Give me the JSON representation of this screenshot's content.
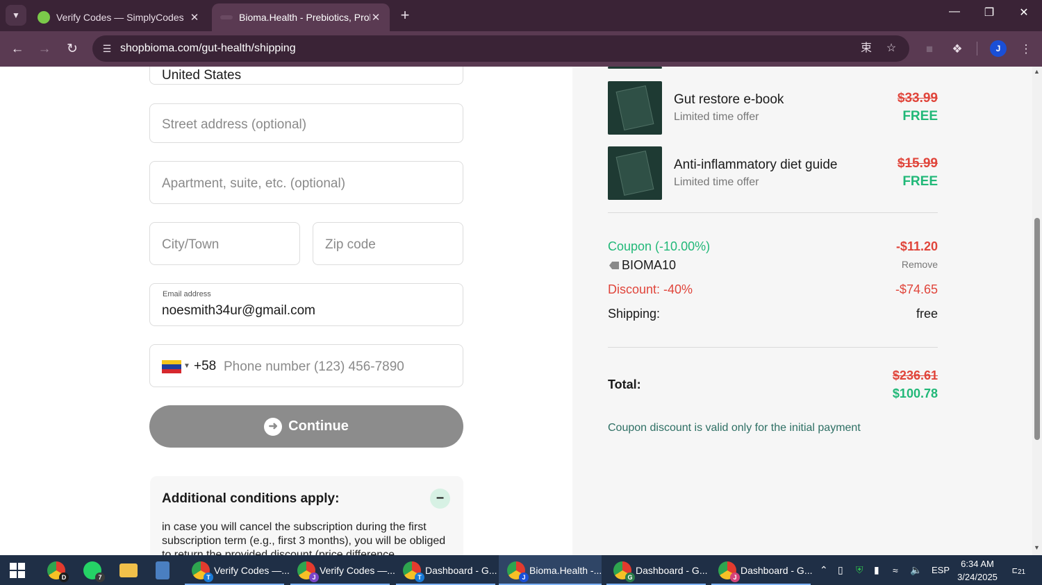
{
  "browser": {
    "tabs": [
      {
        "title": "Verify Codes — SimplyCodes",
        "active": false
      },
      {
        "title": "Bioma.Health - Prebiotics, Probiotics",
        "active": true
      }
    ],
    "url": "shopbioma.com/gut-health/shipping",
    "profile_initial": "J"
  },
  "form": {
    "country_value": "United States",
    "street_placeholder": "Street address (optional)",
    "apartment_placeholder": "Apartment, suite, etc. (optional)",
    "city_placeholder": "City/Town",
    "zip_placeholder": "Zip code",
    "email_label": "Email address",
    "email_value": "noesmith34ur@gmail.com",
    "phone_dial_code": "+58",
    "phone_placeholder": "Phone number (123) 456-7890",
    "continue_label": "Continue"
  },
  "conditions": {
    "title": "Additional conditions apply:",
    "text": "in case you will cancel the subscription during the first subscription term (e.g., first 3 months), you will be obliged to return the provided discount (price difference"
  },
  "order": {
    "products": [
      {
        "name": "Gut restore e-book",
        "subtitle": "Limited time offer",
        "old_price": "$33.99",
        "price": "FREE"
      },
      {
        "name": "Anti-inflammatory diet guide",
        "subtitle": "Limited time offer",
        "old_price": "$15.99",
        "price": "FREE"
      }
    ],
    "coupon_label": "Coupon (-10.00%)",
    "coupon_value": "-$11.20",
    "coupon_code": "BIOMA10",
    "coupon_remove": "Remove",
    "discount_label": "Discount: -40%",
    "discount_value": "-$74.65",
    "shipping_label": "Shipping:",
    "shipping_value": "free",
    "total_label": "Total:",
    "total_old": "$236.61",
    "total_new": "$100.78",
    "note": "Coupon discount is valid only for the initial payment"
  },
  "taskbar": {
    "whatsapp_badge": "7",
    "windows": [
      {
        "label": "Verify Codes —...",
        "badge": "T"
      },
      {
        "label": "Verify Codes —...",
        "badge": "J"
      },
      {
        "label": "Dashboard - G...",
        "badge": "T"
      },
      {
        "label": "Bioma.Health -...",
        "badge": "J"
      },
      {
        "label": "Dashboard - G...",
        "badge": "G"
      },
      {
        "label": "Dashboard - G...",
        "badge": "J"
      }
    ],
    "language": "ESP",
    "time": "6:34 AM",
    "date": "3/24/2025",
    "notifications": "21"
  },
  "colors": {
    "accent_green": "#21b878",
    "price_red": "#e0453b",
    "continue_gray": "#8c8c8c",
    "chrome_frame": "#3a2336"
  }
}
